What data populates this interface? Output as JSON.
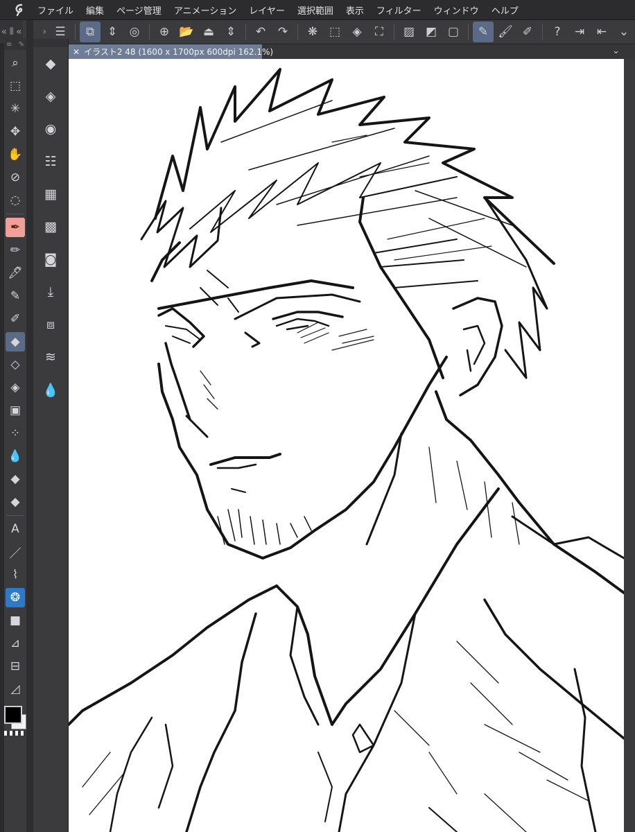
{
  "app": {
    "menu": [
      "ファイル",
      "編集",
      "ページ管理",
      "アニメーション",
      "レイヤー",
      "選択範囲",
      "表示",
      "フィルター",
      "ウィンドウ",
      "ヘルプ"
    ]
  },
  "toolbar": {
    "buttons": [
      {
        "name": "menu-icon",
        "glyph": "☰"
      },
      {
        "name": "canvas-icon",
        "glyph": "⧉",
        "active": true
      },
      {
        "name": "updown-icon",
        "glyph": "⇕"
      },
      {
        "name": "spiral-icon",
        "glyph": "◎"
      },
      {
        "name": "new-file-icon",
        "glyph": "⊕"
      },
      {
        "name": "open-folder-icon",
        "glyph": "📂"
      },
      {
        "name": "save-icon",
        "glyph": "⏏"
      },
      {
        "name": "updown2-icon",
        "glyph": "⇕"
      },
      {
        "name": "undo-icon",
        "glyph": "↶"
      },
      {
        "name": "redo-icon",
        "glyph": "↷"
      },
      {
        "name": "selection-loading-icon",
        "glyph": "❋"
      },
      {
        "name": "deselect-icon",
        "glyph": "⬚"
      },
      {
        "name": "fill-icon",
        "glyph": "◈"
      },
      {
        "name": "transform-icon",
        "glyph": "⛶"
      },
      {
        "name": "clear-outside-icon",
        "glyph": "▨"
      },
      {
        "name": "clear-icon",
        "glyph": "◩"
      },
      {
        "name": "select-box-icon",
        "glyph": "▢"
      },
      {
        "name": "pen-stabilize-icon",
        "glyph": "✎",
        "active": true
      },
      {
        "name": "brush-icon",
        "glyph": "🖌"
      },
      {
        "name": "pen-line-icon",
        "glyph": "✐"
      },
      {
        "name": "help-icon",
        "glyph": "?"
      },
      {
        "name": "export-icon",
        "glyph": "⇥"
      },
      {
        "name": "exit-icon",
        "glyph": "⇤"
      },
      {
        "name": "expand-icon",
        "glyph": "⌄"
      }
    ]
  },
  "tools": [
    {
      "name": "zoom-icon",
      "glyph": "⌕"
    },
    {
      "name": "object-select-icon",
      "glyph": "⬚"
    },
    {
      "name": "magic-wand-icon",
      "glyph": "✳"
    },
    {
      "name": "move-icon",
      "glyph": "✥"
    },
    {
      "name": "hand-icon",
      "glyph": "✋"
    },
    {
      "name": "eyedropper-icon",
      "glyph": "⊘"
    },
    {
      "name": "lasso-icon",
      "glyph": "◌"
    },
    {
      "name": "pen-icon",
      "glyph": "✒",
      "state": "pen-active"
    },
    {
      "name": "pencil-icon",
      "glyph": "✏"
    },
    {
      "name": "brush-tool-icon",
      "glyph": "🖋"
    },
    {
      "name": "marker-icon",
      "glyph": "✎"
    },
    {
      "name": "airbrush-icon",
      "glyph": "✐"
    },
    {
      "name": "eraser-icon",
      "glyph": "◆",
      "state": "active"
    },
    {
      "name": "blend-icon",
      "glyph": "◇"
    },
    {
      "name": "soft-eraser-icon",
      "glyph": "◈"
    },
    {
      "name": "gradient-icon",
      "glyph": "▣"
    },
    {
      "name": "spray-icon",
      "glyph": "⁘"
    },
    {
      "name": "water-drop-icon",
      "glyph": "💧"
    },
    {
      "name": "fill-bucket-icon",
      "glyph": "◆"
    },
    {
      "name": "fill-alt-icon",
      "glyph": "◆"
    },
    {
      "name": "text-icon",
      "glyph": "A"
    },
    {
      "name": "line-icon",
      "glyph": "／"
    },
    {
      "name": "balloon-icon",
      "glyph": "⌇"
    },
    {
      "name": "decoration-icon",
      "glyph": "❂",
      "state": "blue"
    },
    {
      "name": "frame-icon",
      "glyph": "■"
    },
    {
      "name": "ruler-icon",
      "glyph": "⊿"
    },
    {
      "name": "layer-move-icon",
      "glyph": "⊟"
    },
    {
      "name": "correction-icon",
      "glyph": "◿"
    }
  ],
  "subtools": [
    {
      "name": "tool-property-icon",
      "glyph": "◆"
    },
    {
      "name": "eraser-settings-icon",
      "glyph": "◈"
    },
    {
      "name": "eraser-sub-icon",
      "glyph": "◉"
    },
    {
      "name": "brush-size-icon",
      "glyph": "☷"
    },
    {
      "name": "animation-icon",
      "glyph": "▦"
    },
    {
      "name": "material-icon",
      "glyph": "▩"
    },
    {
      "name": "navigator-icon",
      "glyph": "◙"
    },
    {
      "name": "import-icon",
      "glyph": "⤓"
    },
    {
      "name": "layer-property-icon",
      "glyph": "⧈"
    },
    {
      "name": "layers-icon",
      "glyph": "≋"
    },
    {
      "name": "color-mix-icon",
      "glyph": "💧"
    }
  ],
  "document": {
    "tab_label": "イラスト2 48 (1600 x 1700px 600dpi 162.1%)"
  },
  "colors": {
    "main": "#000000",
    "sub": "#f2f2f2"
  }
}
